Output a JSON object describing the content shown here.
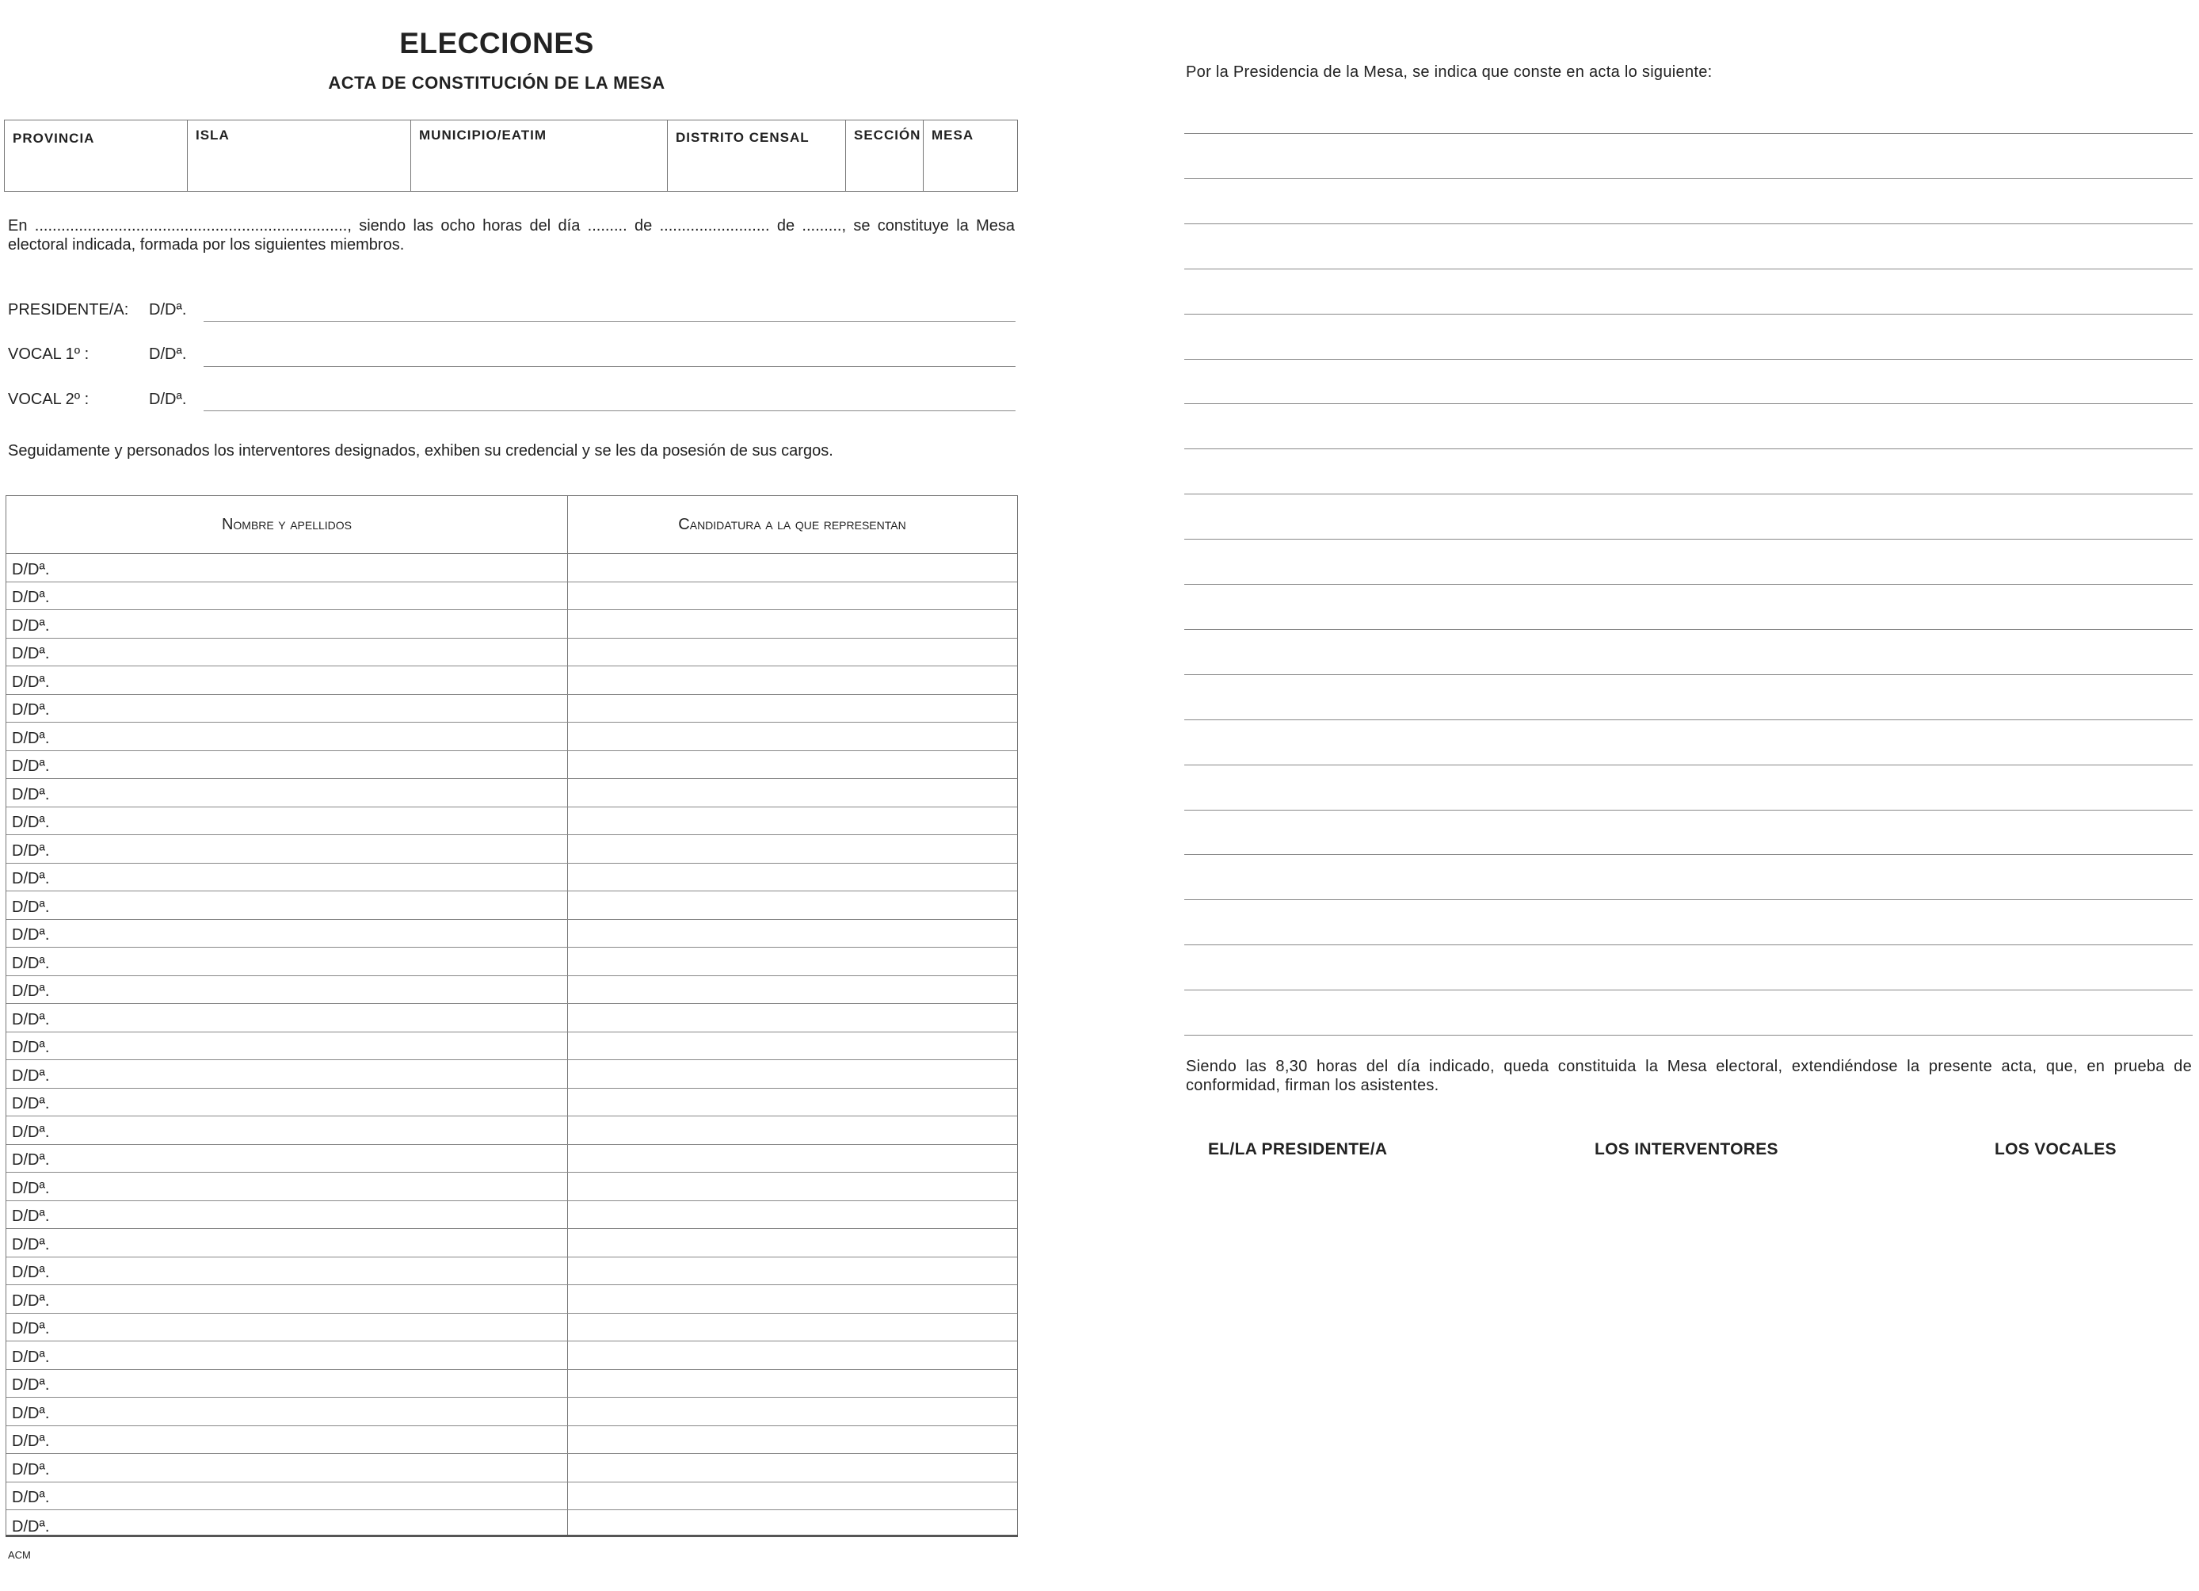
{
  "document": {
    "title": "ELECCIONES",
    "subtitle": "ACTA DE CONSTITUCIÓN DE LA MESA"
  },
  "header_fields": [
    "PROVINCIA",
    "ISLA",
    "MUNICIPIO/EATIM",
    "DISTRITO CENSAL",
    "SECCIÓN",
    "MESA"
  ],
  "intro_paragraph": "En ......................................................................., siendo las ocho horas del día ......... de ......................... de .........,  se constituye la Mesa electoral indicada, formada por los siguientes miembros.",
  "members": [
    {
      "role": "PRESIDENTE/A:",
      "prefix": "D/Dª."
    },
    {
      "role": "VOCAL 1º :",
      "prefix": "D/Dª."
    },
    {
      "role": "VOCAL 2º :",
      "prefix": "D/Dª."
    }
  ],
  "interventores_paragraph": "Seguidamente y personados los interventores designados, exhiben su credencial y se les da posesión de sus cargos.",
  "roster": {
    "col_name": "Nombre y apellidos",
    "col_candidacy": "Candidatura a la que representan",
    "row_prefix": "D/Dª.",
    "row_count": 35
  },
  "footnote": "ACM",
  "right_intro": "Por la Presidencia de la Mesa, se indica que conste en acta lo siguiente:",
  "note_line_count": 21,
  "closing_paragraph": "Siendo las 8,30 horas del día indicado, queda constituida la Mesa electoral, extendiéndose la presente acta, que, en prueba de conformidad, firman los asistentes.",
  "signatures": {
    "president": "EL/LA PRESIDENTE/A",
    "interventores": "LOS INTERVENTORES",
    "vocales": "LOS VOCALES"
  }
}
